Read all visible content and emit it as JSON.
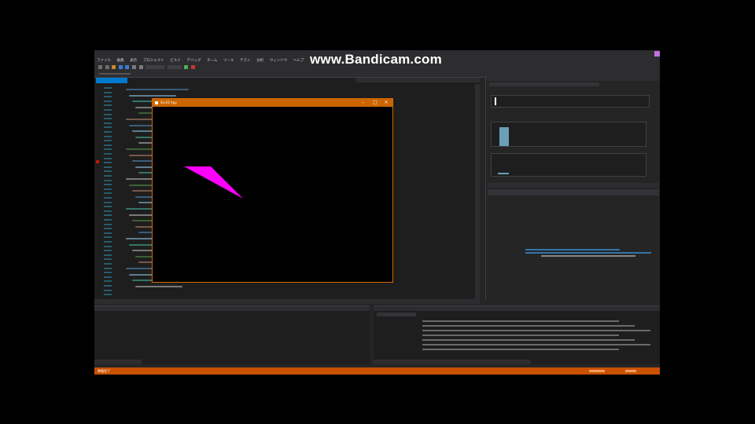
{
  "watermark": "www.Bandicam.com",
  "menu": [
    "ファイル",
    "編集",
    "表示",
    "プロジェクト",
    "ビルド",
    "デバッグ",
    "チーム",
    "ツール",
    "テスト",
    "分析",
    "ウィンドウ",
    "ヘルプ"
  ],
  "app_window": {
    "title": "Siv3D App",
    "shape_color": "#ff00ff"
  },
  "status": {
    "ready": "準備完了"
  },
  "colors": {
    "accent": "#007acc",
    "status_bar": "#ca5100",
    "app_title_bar": "#cc6600"
  }
}
